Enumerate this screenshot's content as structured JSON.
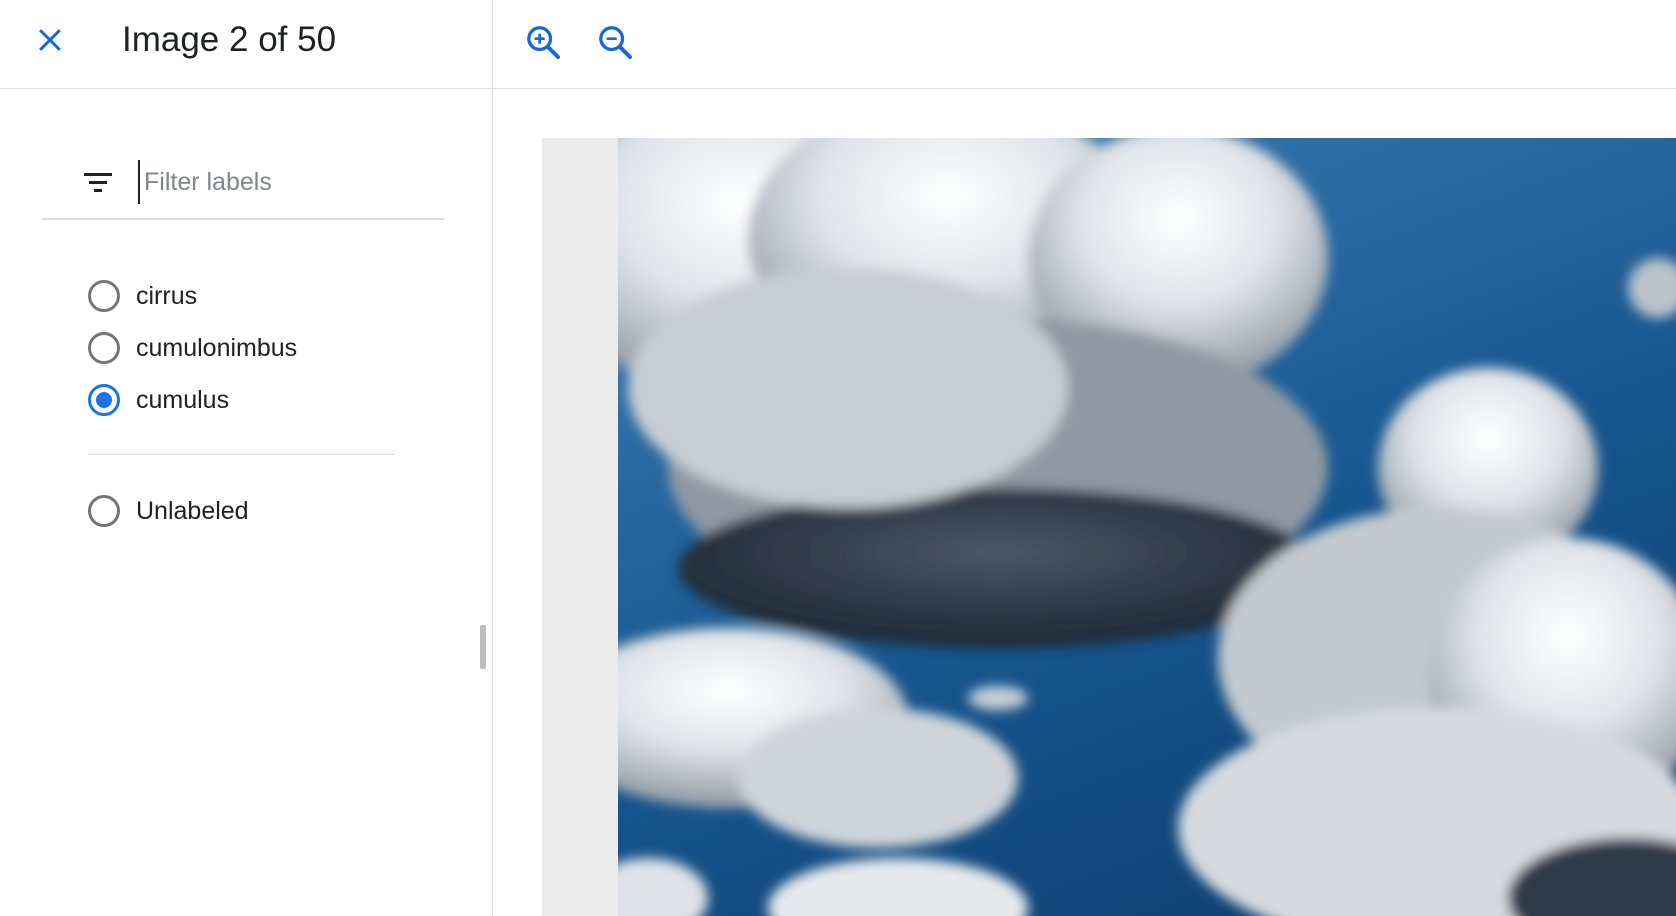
{
  "header": {
    "title": "Image 2 of 50",
    "close_icon": "close-icon"
  },
  "filter": {
    "placeholder": "Filter labels",
    "value": "",
    "icon": "filter-list-icon"
  },
  "labels": [
    {
      "label": "cirrus",
      "checked": false
    },
    {
      "label": "cumulonimbus",
      "checked": false
    },
    {
      "label": "cumulus",
      "checked": true
    }
  ],
  "unlabeled": {
    "label": "Unlabeled",
    "checked": false
  },
  "toolbar": {
    "zoom_in_icon": "zoom-in-icon",
    "zoom_out_icon": "zoom-out-icon"
  },
  "colors": {
    "accent": "#1a73e8",
    "icon_blue": "#1967d2",
    "divider": "#dadce0",
    "radio_unchecked": "#757575",
    "canvas_bg": "#ebebeb"
  }
}
